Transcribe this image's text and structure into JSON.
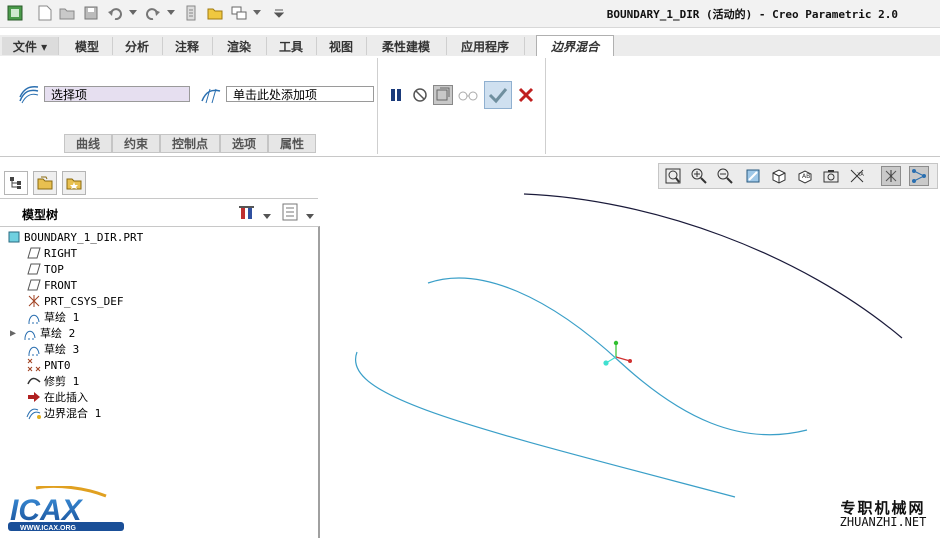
{
  "window": {
    "title": "BOUNDARY_1_DIR (活动的) - Creo Parametric 2.0"
  },
  "ribbon": {
    "tabs": [
      {
        "label": "文件 ▾"
      },
      {
        "label": "模型"
      },
      {
        "label": "分析"
      },
      {
        "label": "注释"
      },
      {
        "label": "渲染"
      },
      {
        "label": "工具"
      },
      {
        "label": "视图"
      },
      {
        "label": "柔性建模"
      },
      {
        "label": "应用程序"
      },
      {
        "label": "边界混合"
      }
    ],
    "first_direction": {
      "value": "选择项"
    },
    "second_direction": {
      "value": "单击此处添加项"
    },
    "subtabs": [
      {
        "label": "曲线"
      },
      {
        "label": "约束"
      },
      {
        "label": "控制点"
      },
      {
        "label": "选项"
      },
      {
        "label": "属性"
      }
    ]
  },
  "model_tree": {
    "header": "模型树",
    "items": [
      {
        "label": "BOUNDARY_1_DIR.PRT",
        "icon": "part-icon"
      },
      {
        "label": "RIGHT",
        "icon": "datum-plane-icon"
      },
      {
        "label": "TOP",
        "icon": "datum-plane-icon"
      },
      {
        "label": "FRONT",
        "icon": "datum-plane-icon"
      },
      {
        "label": "PRT_CSYS_DEF",
        "icon": "csys-icon"
      },
      {
        "label": "草绘 1",
        "icon": "sketch-icon"
      },
      {
        "label": "草绘 2",
        "icon": "sketch-icon"
      },
      {
        "label": "草绘 3",
        "icon": "sketch-icon"
      },
      {
        "label": "PNT0",
        "icon": "datum-point-icon"
      },
      {
        "label": "修剪 1",
        "icon": "trim-icon"
      },
      {
        "label": "在此插入",
        "icon": "insert-arrow-icon"
      },
      {
        "label": "边界混合 1",
        "icon": "boundary-blend-icon"
      }
    ]
  },
  "watermarks": {
    "logo_text": "ICAX",
    "logo_url_text": "WWW.ICAX.ORG",
    "brand_cn": "专职机械网",
    "brand_url": "ZHUANZHI.NET"
  },
  "colors": {
    "curve": "#3a9fc8",
    "curve_dark": "#1a1a3a",
    "csys_x": "#d03030",
    "csys_y": "#30c030",
    "csys_z": "#40e0d0"
  }
}
